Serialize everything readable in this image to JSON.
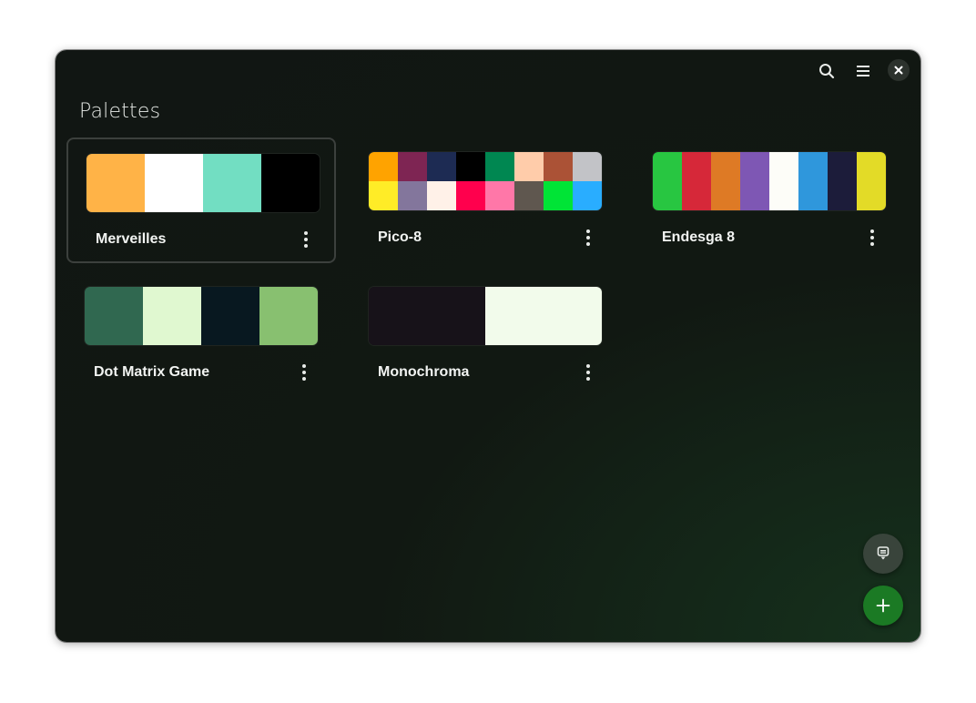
{
  "header": {
    "search_icon": "search-icon",
    "menu_icon": "hamburger-menu-icon",
    "close_icon": "close-icon"
  },
  "page": {
    "title": "Palettes"
  },
  "palettes": [
    {
      "name": "Merveilles",
      "rows": 1,
      "colors": [
        "#FFB347",
        "#FFFFFF",
        "#72DEC2",
        "#000000"
      ],
      "selected": true
    },
    {
      "name": "Pico-8",
      "rows": 2,
      "colors": [
        "#FFA300",
        "#7E2553",
        "#1D2B53",
        "#000000",
        "#008751",
        "#FFCCAA",
        "#AB5236",
        "#C2C3C7",
        "#FFEC27",
        "#83769C",
        "#FFF1E8",
        "#FF004D",
        "#FF77A8",
        "#5F574F",
        "#00E436",
        "#29ADFF"
      ],
      "selected": false
    },
    {
      "name": "Endesga 8",
      "rows": 1,
      "colors": [
        "#28C641",
        "#D62839",
        "#DE7A25",
        "#7E57B4",
        "#FDFDF8",
        "#2F97DC",
        "#1C1C3A",
        "#E3DB27"
      ],
      "selected": false
    },
    {
      "name": "Dot Matrix Game",
      "rows": 1,
      "colors": [
        "#306850",
        "#E0F8D0",
        "#081820",
        "#88C070"
      ],
      "selected": false
    },
    {
      "name": "Monochroma",
      "rows": 1,
      "colors": [
        "#171219",
        "#F2FBEB"
      ],
      "selected": false
    }
  ],
  "fab": {
    "secondary_icon": "picker-icon",
    "primary_icon": "plus-icon"
  },
  "colors": {
    "accent": "#1B7A24",
    "window_bg": "#111613",
    "text": "#F2F4F2"
  }
}
